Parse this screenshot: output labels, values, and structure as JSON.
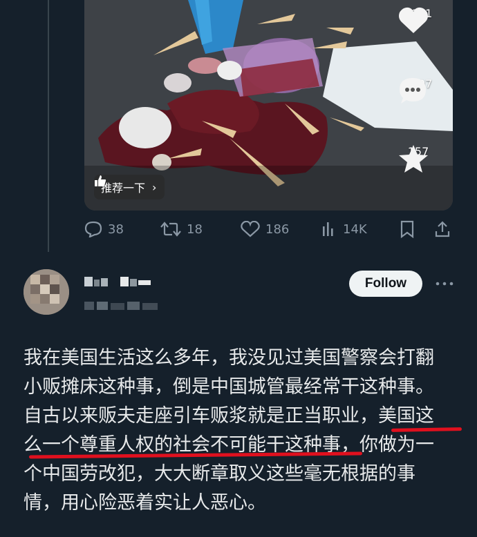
{
  "media": {
    "recommend_label": "推荐一下",
    "likes": "3901",
    "comments": "2307",
    "favorites": "157"
  },
  "tweet_actions": {
    "replies": "38",
    "retweets": "18",
    "likes": "186",
    "views": "14K"
  },
  "reply": {
    "follow_label": "Follow",
    "text_lines": [
      "我在美国生活这么多年，我没见过美国警察会打翻",
      "小贩摊床这种事，倒是中国城管最经常干这种事。",
      "自古以来贩夫走座引车贩浆就是正当职业，美国这",
      "么一个尊重人权的社会不可能干这种事，你做为一",
      "个中国劳改犯，大大断章取义这些毫无根据的事",
      "情，用心险恶着实让人恶心。"
    ]
  },
  "colors": {
    "background": "#15202b",
    "muted": "#8b98a5",
    "underline": "#e0101e"
  }
}
